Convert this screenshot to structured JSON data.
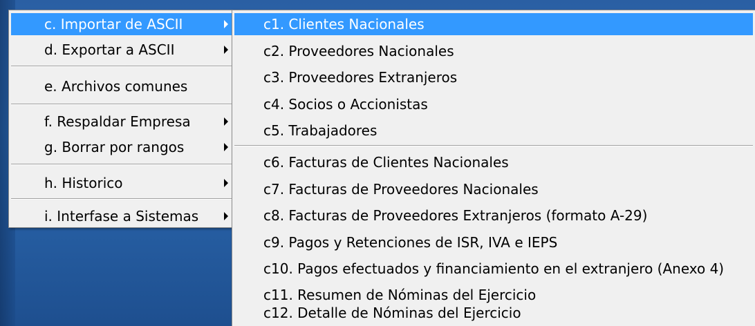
{
  "main_menu": {
    "items": [
      {
        "label": "c. Importar de ASCII",
        "has_submenu": true,
        "selected": true
      },
      {
        "label": "d. Exportar a ASCII",
        "has_submenu": true,
        "selected": false
      },
      {
        "label": "e. Archivos comunes",
        "has_submenu": false,
        "selected": false
      },
      {
        "label": "f. Respaldar Empresa",
        "has_submenu": true,
        "selected": false
      },
      {
        "label": "g. Borrar por rangos",
        "has_submenu": true,
        "selected": false
      },
      {
        "label": "h. Historico",
        "has_submenu": true,
        "selected": false
      },
      {
        "label": "i. Interfase a Sistemas",
        "has_submenu": true,
        "selected": false
      }
    ]
  },
  "submenu": {
    "items": [
      {
        "label": "c1. Clientes Nacionales",
        "selected": true
      },
      {
        "label": "c2. Proveedores Nacionales",
        "selected": false
      },
      {
        "label": "c3. Proveedores Extranjeros",
        "selected": false
      },
      {
        "label": "c4. Socios o Accionistas",
        "selected": false
      },
      {
        "label": "c5. Trabajadores",
        "selected": false
      },
      {
        "label": "c6. Facturas de Clientes Nacionales",
        "selected": false
      },
      {
        "label": "c7. Facturas de Proveedores Nacionales",
        "selected": false
      },
      {
        "label": "c8. Facturas de Proveedores Extranjeros (formato A-29)",
        "selected": false
      },
      {
        "label": "c9. Pagos y Retenciones de ISR, IVA e IEPS",
        "selected": false
      },
      {
        "label": "c10. Pagos efectuados y financiamiento en el extranjero (Anexo 4)",
        "selected": false
      },
      {
        "label": "c11. Resumen de Nóminas del Ejercicio",
        "selected": false
      },
      {
        "label": "c12. Detalle de Nóminas del Ejercicio",
        "selected": false
      }
    ]
  },
  "colors": {
    "highlight": "#3399ff",
    "menu_bg": "#f0f0f0"
  }
}
